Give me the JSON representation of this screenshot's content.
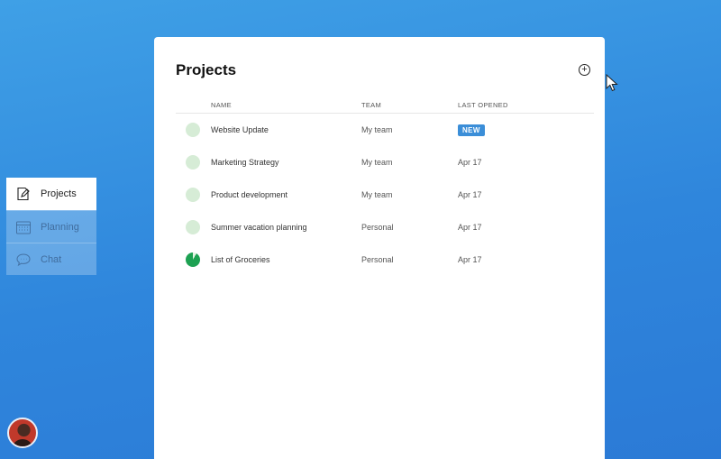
{
  "sidebar": {
    "items": [
      {
        "label": "Projects",
        "icon": "edit-document-icon",
        "active": true
      },
      {
        "label": "Planning",
        "icon": "calendar-icon",
        "active": false
      },
      {
        "label": "Chat",
        "icon": "chat-bubble-icon",
        "active": false
      }
    ]
  },
  "main": {
    "title": "Projects",
    "add_icon": "plus-circle-icon",
    "columns": {
      "name": "NAME",
      "team": "TEAM",
      "last_opened": "LAST OPENED"
    },
    "rows": [
      {
        "name": "Website Update",
        "team": "My team",
        "last_opened": "",
        "badge": "NEW",
        "status": "empty"
      },
      {
        "name": "Marketing Strategy",
        "team": "My team",
        "last_opened": "Apr 17",
        "status": "empty"
      },
      {
        "name": "Product development",
        "team": "My team",
        "last_opened": "Apr 17",
        "status": "empty"
      },
      {
        "name": "Summer vacation planning",
        "team": "Personal",
        "last_opened": "Apr 17",
        "status": "empty"
      },
      {
        "name": "List of Groceries",
        "team": "Personal",
        "last_opened": "Apr 17",
        "status": "partial",
        "progress": 0.92
      }
    ]
  },
  "colors": {
    "accent": "#3b8ed8",
    "progress_green": "#1da152",
    "background": "#2f86dc"
  }
}
